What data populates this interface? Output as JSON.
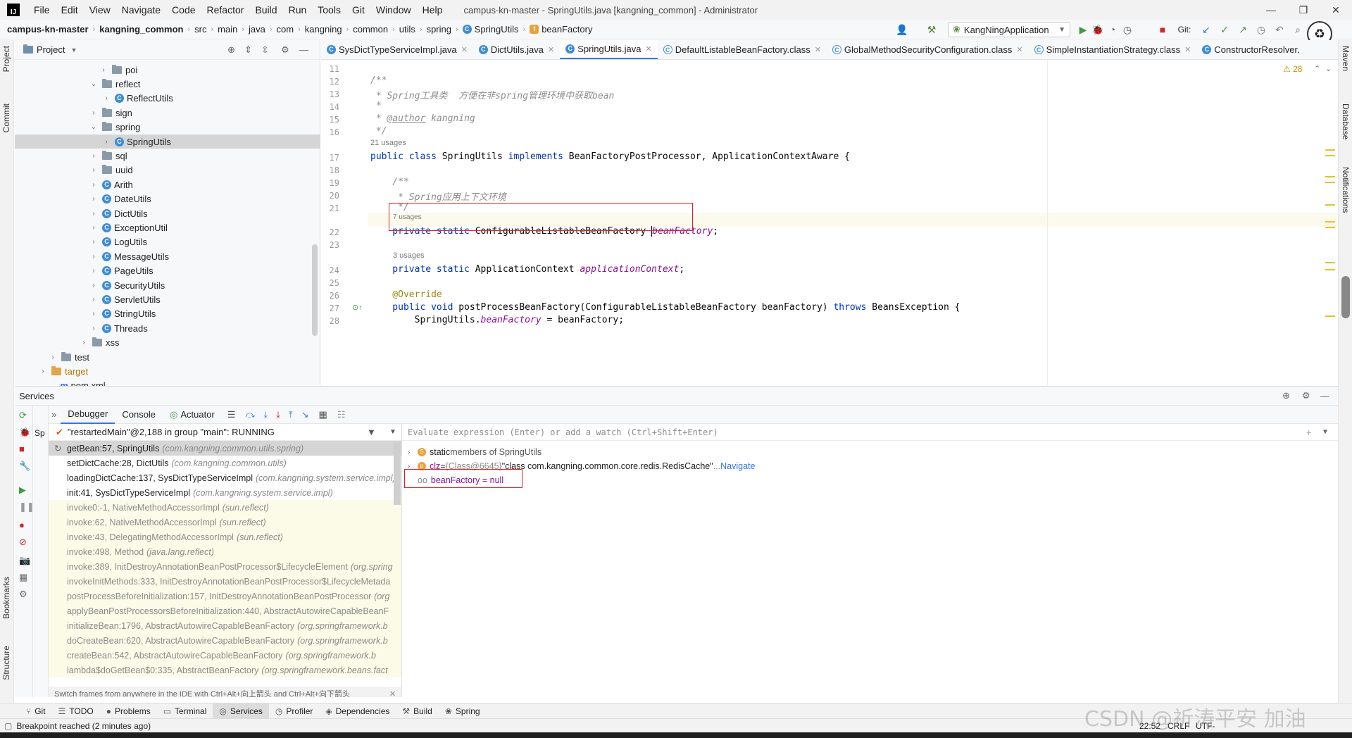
{
  "menu": [
    "File",
    "Edit",
    "View",
    "Navigate",
    "Code",
    "Refactor",
    "Build",
    "Run",
    "Tools",
    "Git",
    "Window",
    "Help"
  ],
  "window_title": "campus-kn-master - SpringUtils.java [kangning_common] - Administrator",
  "breadcrumb": [
    "campus-kn-master",
    "kangning_common",
    "src",
    "main",
    "java",
    "com",
    "kangning",
    "common",
    "utils",
    "spring",
    "SpringUtils",
    "beanFactory"
  ],
  "run_config": "KangNingApplication",
  "git_label": "Git:",
  "project_panel": {
    "title": "Project",
    "tree": [
      {
        "name": "poi",
        "type": "folder",
        "expanded": false
      },
      {
        "name": "reflect",
        "type": "folder",
        "expanded": true
      },
      {
        "name": "ReflectUtils",
        "type": "class",
        "expanded": false
      },
      {
        "name": "sign",
        "type": "folder",
        "expanded": false
      },
      {
        "name": "spring",
        "type": "folder",
        "expanded": true
      },
      {
        "name": "SpringUtils",
        "type": "class",
        "expanded": false,
        "selected": true
      },
      {
        "name": "sql",
        "type": "folder",
        "expanded": false
      },
      {
        "name": "uuid",
        "type": "folder",
        "expanded": false
      },
      {
        "name": "Arith",
        "type": "class"
      },
      {
        "name": "DateUtils",
        "type": "class"
      },
      {
        "name": "DictUtils",
        "type": "class"
      },
      {
        "name": "ExceptionUtil",
        "type": "class"
      },
      {
        "name": "LogUtils",
        "type": "class"
      },
      {
        "name": "MessageUtils",
        "type": "class"
      },
      {
        "name": "PageUtils",
        "type": "class"
      },
      {
        "name": "SecurityUtils",
        "type": "class"
      },
      {
        "name": "ServletUtils",
        "type": "class"
      },
      {
        "name": "StringUtils",
        "type": "class"
      },
      {
        "name": "Threads",
        "type": "class"
      },
      {
        "name": "xss",
        "type": "folder"
      },
      {
        "name": "test",
        "type": "folder"
      },
      {
        "name": "target",
        "type": "folder-orange"
      },
      {
        "name": "pom.xml",
        "type": "maven"
      }
    ]
  },
  "editor_tabs": [
    "SysDictTypeServiceImpl.java",
    "DictUtils.java",
    "SpringUtils.java",
    "DefaultListableBeanFactory.class",
    "GlobalMethodSecurityConfiguration.class",
    "SimpleInstantiationStrategy.class",
    "ConstructorResolver."
  ],
  "active_tab": "SpringUtils.java",
  "warnings_count": "28",
  "editor": {
    "line_numbers": [
      "11",
      "12",
      "13",
      "14",
      "15",
      "16",
      "17",
      "18",
      "19",
      "20",
      "21",
      "22",
      "23",
      "24",
      "25",
      "26",
      "27",
      "28"
    ],
    "usages": {
      "class": "21 usages",
      "beanFactory": "7 usages",
      "applicationContext": "3 usages"
    },
    "lines": {
      "l12": "/**",
      "l13": " * Spring工具类  方便在非spring管理环境中获取bean",
      "l14": " *",
      "l15a": " * ",
      "l15b": "@author",
      "l15c": " kangning",
      "l16": " */",
      "l17a": "public class",
      "l17b": " SpringUtils ",
      "l17c": "implements",
      "l17d": " BeanFactoryPostProcessor, ApplicationContextAware {",
      "l19": "    /**",
      "l20": "     * Spring应用上下文环境",
      "l21": "     */",
      "l22a": "    private static",
      "l22b": " ConfigurableListableBeanFactory ",
      "l22c": "beanFactory",
      "l22d": ";",
      "l24a": "    private static",
      "l24b": " ApplicationContext ",
      "l24c": "applicationContext",
      "l24d": ";",
      "l26": "    @Override",
      "l27a": "    public void",
      "l27b": " postProcessBeanFactory(ConfigurableListableBeanFactory beanFactory) ",
      "l27c": "throws",
      "l27d": " BeansException {",
      "l28a": "        SpringUtils.",
      "l28b": "beanFactory",
      "l28c": " = beanFactory;"
    }
  },
  "services": {
    "title": "Services",
    "tabs": [
      "Debugger",
      "Console",
      "Actuator"
    ],
    "thread": "\"restartedMain\"@2,188 in group \"main\": RUNNING",
    "frames": [
      {
        "method": "getBean:57, SpringUtils",
        "pkg": "(com.kangning.common.utils.spring)",
        "kind": "sel"
      },
      {
        "method": "setDictCache:28, DictUtils",
        "pkg": "(com.kangning.common.utils)",
        "kind": "user"
      },
      {
        "method": "loadingDictCache:137, SysDictTypeServiceImpl",
        "pkg": "(com.kangning.system.service.impl)",
        "kind": "user"
      },
      {
        "method": "init:41, SysDictTypeServiceImpl",
        "pkg": "(com.kangning.system.service.impl)",
        "kind": "user"
      },
      {
        "method": "invoke0:-1, NativeMethodAccessorImpl",
        "pkg": "(sun.reflect)",
        "kind": "lib"
      },
      {
        "method": "invoke:62, NativeMethodAccessorImpl",
        "pkg": "(sun.reflect)",
        "kind": "lib"
      },
      {
        "method": "invoke:43, DelegatingMethodAccessorImpl",
        "pkg": "(sun.reflect)",
        "kind": "lib"
      },
      {
        "method": "invoke:498, Method",
        "pkg": "(java.lang.reflect)",
        "kind": "lib"
      },
      {
        "method": "invoke:389, InitDestroyAnnotationBeanPostProcessor$LifecycleElement",
        "pkg": "(org.spring",
        "kind": "lib"
      },
      {
        "method": "invokeInitMethods:333, InitDestroyAnnotationBeanPostProcessor$LifecycleMetada",
        "pkg": "",
        "kind": "lib"
      },
      {
        "method": "postProcessBeforeInitialization:157, InitDestroyAnnotationBeanPostProcessor",
        "pkg": "(org",
        "kind": "lib"
      },
      {
        "method": "applyBeanPostProcessorsBeforeInitialization:440, AbstractAutowireCapableBeanF",
        "pkg": "",
        "kind": "lib"
      },
      {
        "method": "initializeBean:1796, AbstractAutowireCapableBeanFactory",
        "pkg": "(org.springframework.b",
        "kind": "lib"
      },
      {
        "method": "doCreateBean:620, AbstractAutowireCapableBeanFactory",
        "pkg": "(org.springframework.b",
        "kind": "lib"
      },
      {
        "method": "createBean:542, AbstractAutowireCapableBeanFactory",
        "pkg": "(org.springframework.b",
        "kind": "lib"
      },
      {
        "method": "lambda$doGetBean$0:335, AbstractBeanFactory",
        "pkg": "(org.springframework.beans.fact",
        "kind": "lib"
      }
    ],
    "frames_hint": "Switch frames from anywhere in the IDE with Ctrl+Alt+向上箭头 and Ctrl+Alt+向下箭头",
    "eval_placeholder": "Evaluate expression (Enter) or add a watch (Ctrl+Shift+Enter)",
    "vars": {
      "static_label": "static",
      "static_rest": " members of SpringUtils",
      "clz_name": "clz",
      "clz_eq": " = ",
      "clz_ref": "{Class@6645}",
      "clz_value": " \"class com.kangning.common.core.redis.RedisCache\"",
      "clz_more": "... ",
      "navigate": "Navigate",
      "bf": "beanFactory = null"
    }
  },
  "bottom_tabs": [
    "Git",
    "TODO",
    "Problems",
    "Terminal",
    "Services",
    "Profiler",
    "Dependencies",
    "Build",
    "Spring"
  ],
  "status": {
    "message": "Breakpoint reached (2 minutes ago)",
    "time": "22:52",
    "line_sep": "CRLF",
    "encoding": "UTF-"
  },
  "stripes": {
    "left": [
      "Project",
      "Commit",
      "Bookmarks",
      "Structure"
    ],
    "right": [
      "Maven",
      "Database",
      "Notifications"
    ]
  },
  "watermark": "CSDN @祈涛平安 加油"
}
